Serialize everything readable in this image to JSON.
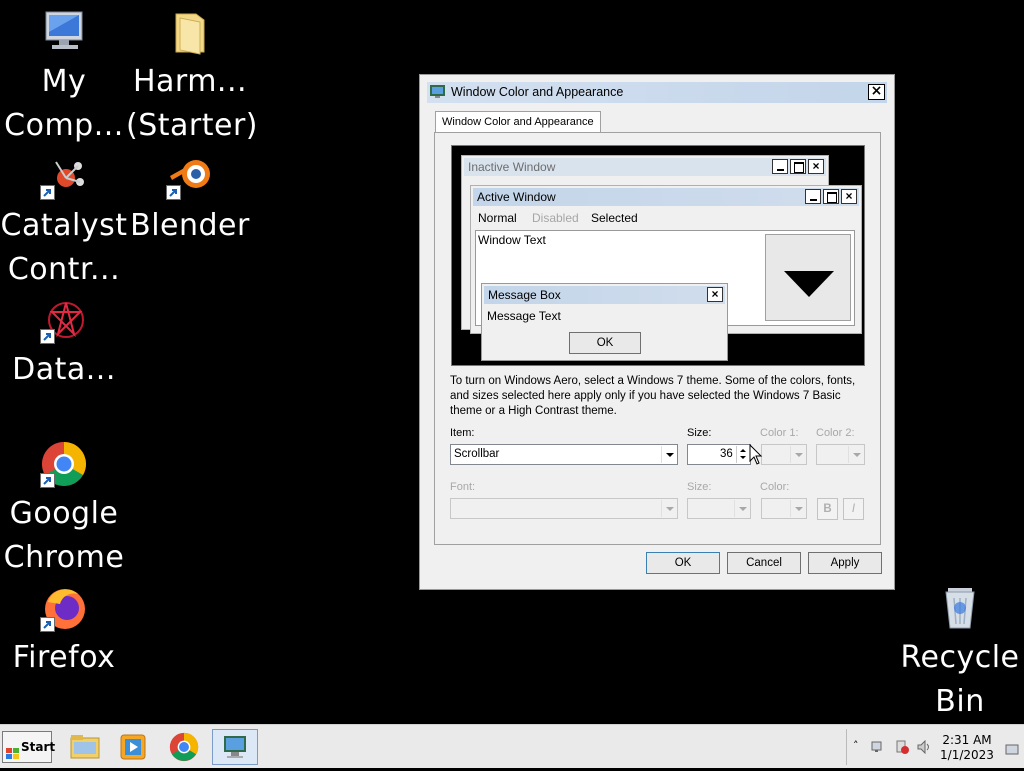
{
  "desktop": {
    "icons": [
      {
        "label": "My\nComp...",
        "icon": "computer-icon"
      },
      {
        "label": "Harm...\n(Starter)",
        "icon": "folder-icon"
      },
      {
        "label": "Catalyst\nContr...",
        "icon": "catalyst-icon"
      },
      {
        "label": "Blender",
        "icon": "blender-icon"
      },
      {
        "label": "Data...",
        "icon": "data-icon"
      },
      {
        "label": "Google\nChrome",
        "icon": "chrome-icon"
      },
      {
        "label": "Firefox",
        "icon": "firefox-icon"
      },
      {
        "label": "Recycle\nBin",
        "icon": "recycle-bin-icon"
      }
    ]
  },
  "dialog": {
    "title": "Window Color and Appearance",
    "tab": "Window Color and Appearance",
    "preview": {
      "inactive_title": "Inactive Window",
      "active_title": "Active Window",
      "menu": [
        "Normal",
        "Disabled",
        "Selected"
      ],
      "window_text": "Window Text",
      "msgbox_title": "Message Box",
      "msgbox_text": "Message Text",
      "msgbox_ok": "OK"
    },
    "info_text": "To turn on Windows Aero, select a Windows 7 theme.  Some of the colors, fonts, and sizes selected here apply only if you have selected the Windows 7 Basic theme or a High Contrast theme.",
    "item_label": "Item:",
    "item_value": "Scrollbar",
    "size_label": "Size:",
    "size_value": "36",
    "color1_label": "Color 1:",
    "color2_label": "Color 2:",
    "font_label": "Font:",
    "font_size_label": "Size:",
    "font_color_label": "Color:",
    "bold_label": "B",
    "italic_label": "I",
    "ok": "OK",
    "cancel": "Cancel",
    "apply": "Apply"
  },
  "taskbar": {
    "start": "Start",
    "time": "2:31 AM",
    "date": "1/1/2023"
  },
  "colors": {
    "desktop_bg": "#000000",
    "active_title": "#c3d5ea",
    "inactive_title": "#d9e3ee"
  }
}
